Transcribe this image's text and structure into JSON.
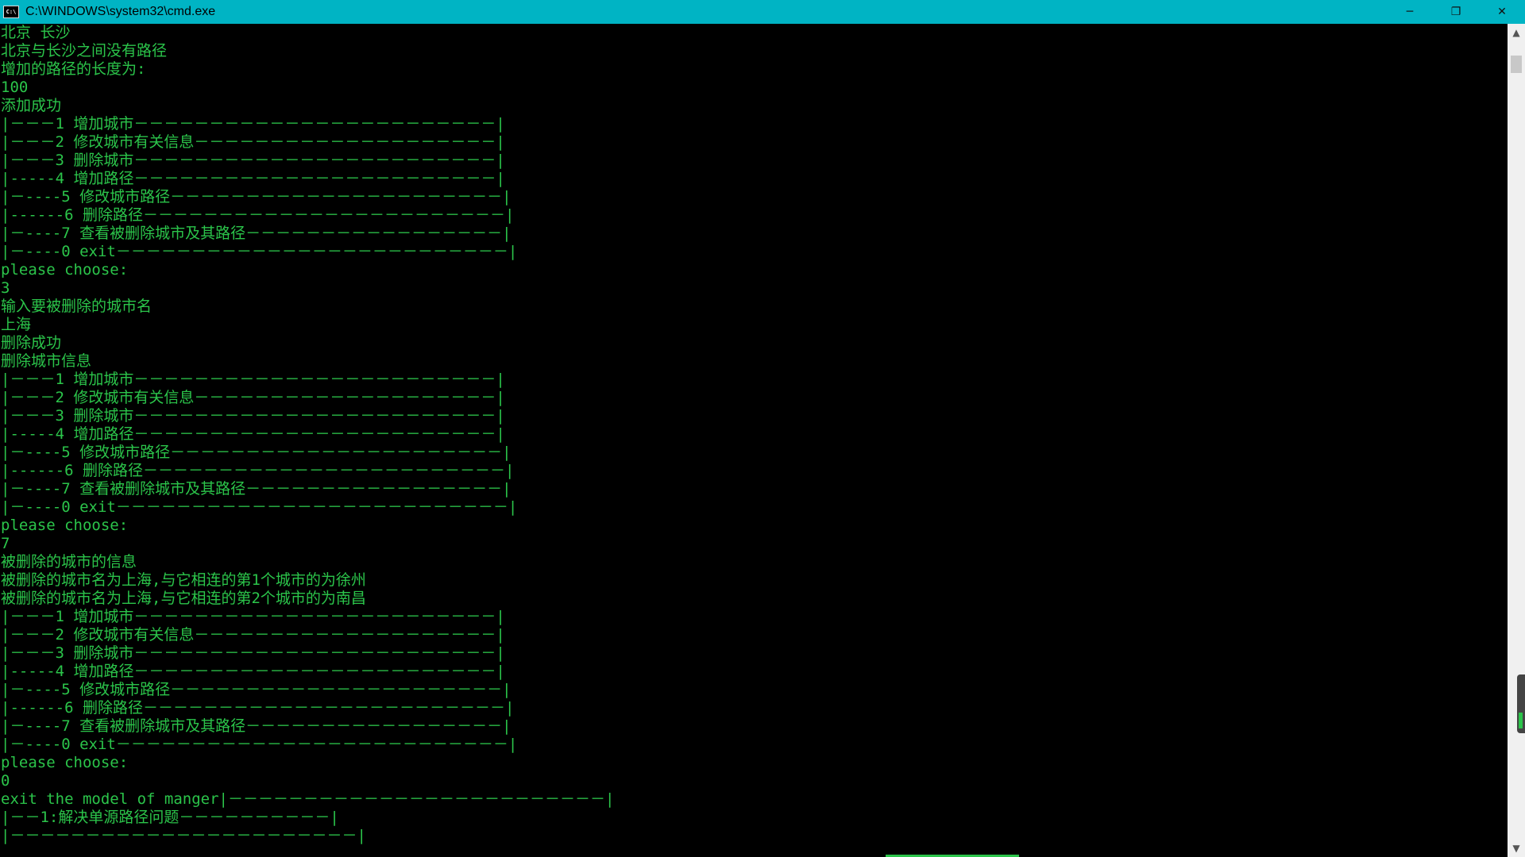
{
  "window": {
    "title": "C:\\WINDOWS\\system32\\cmd.exe",
    "icon_label": "C:\\",
    "minimize": "─",
    "maximize": "❐",
    "close": "✕"
  },
  "scrollbar": {
    "up": "▲",
    "down": "▼"
  },
  "console_lines": [
    "北京 长沙",
    "北京与长沙之间没有路径",
    "增加的路径的长度为:",
    "100",
    "添加成功",
    "|－－－1 增加城市－－－－－－－－－－－－－－－－－－－－－－－－|",
    "|－－－2 修改城市有关信息－－－－－－－－－－－－－－－－－－－－|",
    "|－－－3 删除城市－－－－－－－－－－－－－－－－－－－－－－－－|",
    "|-----4 增加路径－－－－－－－－－－－－－－－－－－－－－－－－|",
    "|－----5 修改城市路径－－－－－－－－－－－－－－－－－－－－－－|",
    "|------6 删除路径－－－－－－－－－－－－－－－－－－－－－－－－|",
    "|－----7 查看被删除城市及其路径－－－－－－－－－－－－－－－－－|",
    "|－----0 exit－－－－－－－－－－－－－－－－－－－－－－－－－－|",
    "please choose:",
    "3",
    "输入要被删除的城市名",
    "上海",
    "删除成功",
    "删除城市信息",
    "|－－－1 增加城市－－－－－－－－－－－－－－－－－－－－－－－－|",
    "|－－－2 修改城市有关信息－－－－－－－－－－－－－－－－－－－－|",
    "|－－－3 删除城市－－－－－－－－－－－－－－－－－－－－－－－－|",
    "|-----4 增加路径－－－－－－－－－－－－－－－－－－－－－－－－|",
    "|－----5 修改城市路径－－－－－－－－－－－－－－－－－－－－－－|",
    "|------6 删除路径－－－－－－－－－－－－－－－－－－－－－－－－|",
    "|－----7 查看被删除城市及其路径－－－－－－－－－－－－－－－－－|",
    "|－----0 exit－－－－－－－－－－－－－－－－－－－－－－－－－－|",
    "please choose:",
    "7",
    "被删除的城市的信息",
    "被删除的城市名为上海,与它相连的第1个城市的为徐州",
    "被删除的城市名为上海,与它相连的第2个城市的为南昌",
    "|－－－1 增加城市－－－－－－－－－－－－－－－－－－－－－－－－|",
    "|－－－2 修改城市有关信息－－－－－－－－－－－－－－－－－－－－|",
    "|－－－3 删除城市－－－－－－－－－－－－－－－－－－－－－－－－|",
    "|-----4 增加路径－－－－－－－－－－－－－－－－－－－－－－－－|",
    "|－----5 修改城市路径－－－－－－－－－－－－－－－－－－－－－－|",
    "|------6 删除路径－－－－－－－－－－－－－－－－－－－－－－－－|",
    "|－----7 查看被删除城市及其路径－－－－－－－－－－－－－－－－－|",
    "|－----0 exit－－－－－－－－－－－－－－－－－－－－－－－－－－|",
    "please choose:",
    "0",
    "exit the model of manger|－－－－－－－－－－－－－－－－－－－－－－－－－|",
    "|－－1:解决单源路径问题－－－－－－－－－－|",
    "|－－－－－－－－－－－－－－－－－－－－－－－|"
  ]
}
